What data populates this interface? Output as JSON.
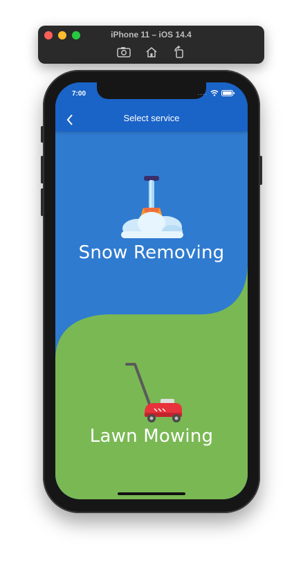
{
  "simulator": {
    "title": "iPhone 11 – iOS 14.4",
    "tools": [
      "screenshot-icon",
      "home-icon",
      "rotate-icon"
    ]
  },
  "status_bar": {
    "time": "7:00",
    "dots": "...."
  },
  "navbar": {
    "title": "Select service",
    "back_icon": "chevron-left-icon"
  },
  "colors": {
    "navbar": "#1a63c7",
    "snow_background": "#2f7bd0",
    "lawn_background": "#7ab854",
    "text": "#ffffff"
  },
  "services": [
    {
      "label": "Snow Removing",
      "icon": "snow-shovel-icon"
    },
    {
      "label": "Lawn Mowing",
      "icon": "lawn-mower-icon"
    }
  ]
}
